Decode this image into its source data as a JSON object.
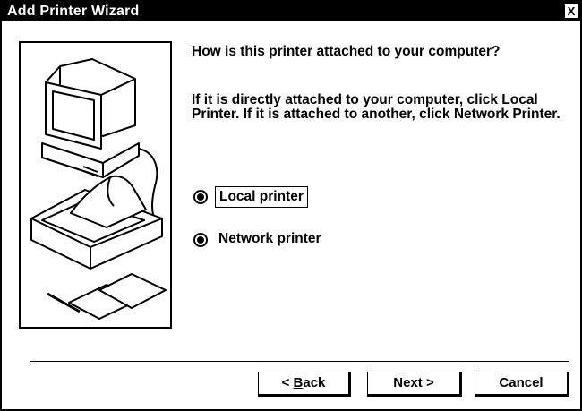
{
  "window": {
    "title": "Add Printer Wizard",
    "close_label": "X"
  },
  "content": {
    "question": "How is this printer attached to your computer?",
    "instructions": "If it is directly attached to your computer, click Local Printer. If it is attached to another, click Network Printer."
  },
  "options": [
    {
      "label": "Local printer",
      "selected": true,
      "focused": true
    },
    {
      "label": "Network printer",
      "selected": true,
      "focused": false
    }
  ],
  "buttons": {
    "back_prefix": "< ",
    "back_mnemonic": "B",
    "back_rest": "ack",
    "next": "Next >",
    "cancel": "Cancel"
  },
  "icons": [
    "computer-printer-illustration",
    "close-icon"
  ]
}
